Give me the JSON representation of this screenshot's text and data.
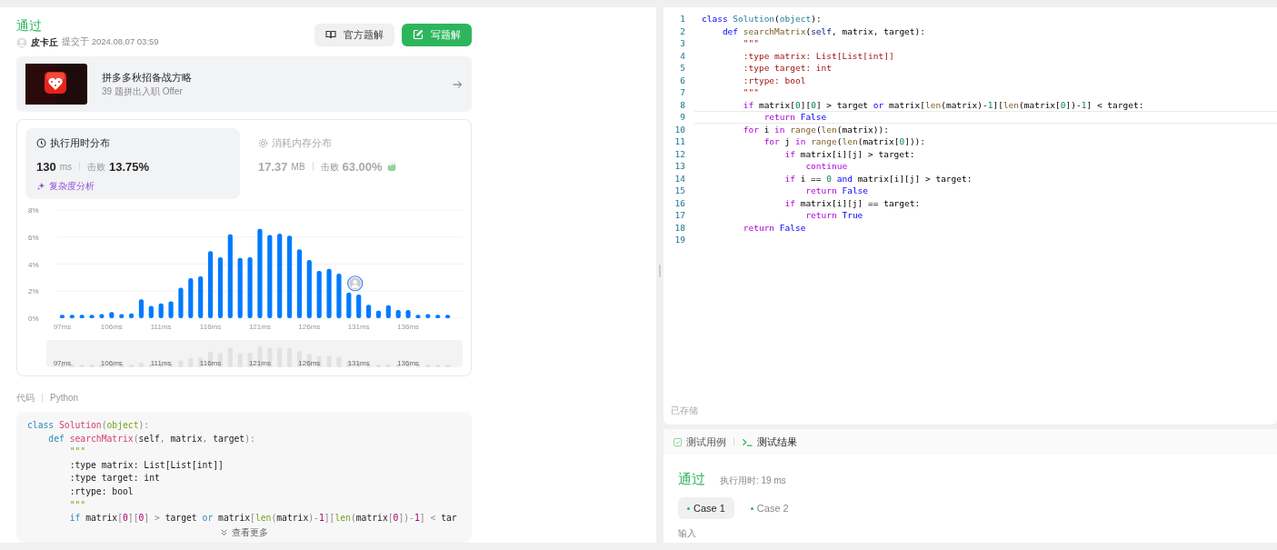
{
  "submission": {
    "status": "通过",
    "author": "皮卡丘",
    "submitted_label": "提交于",
    "time": "2024.08.07 03:59"
  },
  "actions": [
    {
      "label": "官方题解",
      "kind": "secondary"
    },
    {
      "label": "写题解",
      "kind": "primary"
    }
  ],
  "promo": {
    "title": "拼多多秋招备战方略",
    "subtitle": "39 题拼出入职 Offer"
  },
  "stats": [
    {
      "title": "执行用时分布",
      "kind": "time",
      "selected": true,
      "value": "130",
      "unit": "ms",
      "beat_label": "击败",
      "beat": "13.75%",
      "celebrate": false
    },
    {
      "title": "消耗内存分布",
      "kind": "memory",
      "selected": false,
      "value": "17.37",
      "unit": "MB",
      "beat_label": "击败",
      "beat": "63.00%",
      "celebrate": true
    }
  ],
  "analysis_link": "复杂度分析",
  "chart_data": {
    "type": "bar",
    "categories": [
      "97ms",
      null,
      null,
      null,
      null,
      "106ms",
      null,
      null,
      null,
      null,
      "111ms",
      null,
      null,
      null,
      null,
      "116ms",
      null,
      null,
      null,
      null,
      "121ms",
      null,
      null,
      null,
      null,
      "126ms",
      null,
      null,
      null,
      null,
      "131ms",
      null,
      null,
      null,
      null,
      "136ms",
      null,
      null,
      null,
      null
    ],
    "series": [
      {
        "color": "#007aff",
        "values": [
          0.25,
          0.25,
          0.25,
          0.25,
          0.3,
          0.45,
          0.3,
          0.35,
          1.4,
          0.9,
          1.1,
          1.25,
          2.25,
          2.95,
          3.1,
          4.95,
          4.5,
          6.2,
          4.45,
          4.5,
          6.6,
          6.15,
          6.25,
          6.1,
          5.1,
          4.3,
          3.5,
          3.65,
          3.3,
          1.9,
          1.75,
          1.0,
          0.55,
          0.95,
          0.6,
          0.6,
          0.25,
          0.3,
          0.25,
          0.25
        ]
      }
    ],
    "ylim": [
      0,
      8
    ],
    "yticks": [
      {
        "value": 0,
        "label": "0%"
      },
      {
        "value": 2,
        "label": "2%"
      },
      {
        "value": 4,
        "label": "4%"
      },
      {
        "value": 6,
        "label": "6%"
      },
      {
        "value": 8,
        "label": "8%"
      }
    ],
    "grid": true,
    "annotations": [
      {
        "x": "131ms"
      }
    ]
  },
  "brush_labels": [
    "97ms",
    "106ms",
    "111ms",
    "116ms",
    "121ms",
    "126ms",
    "131ms",
    "136ms"
  ],
  "code_header": {
    "label": "代码",
    "language": "Python"
  },
  "code_preview": [
    [
      {
        "kind": "kw",
        "text": "class"
      },
      {
        "kind": "cls",
        "text": " Solution"
      },
      {
        "kind": "p",
        "text": "("
      },
      {
        "kind": "bi",
        "text": "object"
      },
      {
        "kind": "p",
        "text": "):"
      }
    ],
    [
      {
        "kind": "kw",
        "text": "    def"
      },
      {
        "kind": "cls",
        "text": " searchMatrix"
      },
      {
        "kind": "p",
        "text": "("
      },
      {
        "kind": "t",
        "text": "self"
      },
      {
        "kind": "p",
        "text": ", "
      },
      {
        "kind": "t",
        "text": "matrix"
      },
      {
        "kind": "p",
        "text": ", "
      },
      {
        "kind": "t",
        "text": "target"
      },
      {
        "kind": "p",
        "text": "):"
      }
    ],
    [
      {
        "kind": "str",
        "text": "        \"\"\""
      }
    ],
    [
      {
        "kind": "t",
        "text": "        :type matrix: List[List[int]]"
      }
    ],
    [
      {
        "kind": "t",
        "text": "        :type target: int"
      }
    ],
    [
      {
        "kind": "t",
        "text": "        :rtype: bool"
      }
    ],
    [
      {
        "kind": "str",
        "text": "        \"\"\""
      }
    ],
    [
      {
        "kind": "kw",
        "text": "        if"
      },
      {
        "kind": "t",
        "text": " matrix"
      },
      {
        "kind": "p",
        "text": "["
      },
      {
        "kind": "num",
        "text": "0"
      },
      {
        "kind": "p",
        "text": "]["
      },
      {
        "kind": "num",
        "text": "0"
      },
      {
        "kind": "p",
        "text": "]"
      },
      {
        "kind": "p",
        "text": " >"
      },
      {
        "kind": "t",
        "text": " target "
      },
      {
        "kind": "kw",
        "text": "or"
      },
      {
        "kind": "t",
        "text": " matrix"
      },
      {
        "kind": "p",
        "text": "["
      },
      {
        "kind": "bi",
        "text": "len"
      },
      {
        "kind": "p",
        "text": "("
      },
      {
        "kind": "t",
        "text": "matrix"
      },
      {
        "kind": "p",
        "text": ")-"
      },
      {
        "kind": "num",
        "text": "1"
      },
      {
        "kind": "p",
        "text": "]["
      },
      {
        "kind": "bi",
        "text": "len"
      },
      {
        "kind": "p",
        "text": "("
      },
      {
        "kind": "t",
        "text": "matrix"
      },
      {
        "kind": "p",
        "text": "["
      },
      {
        "kind": "num",
        "text": "0"
      },
      {
        "kind": "p",
        "text": "])-"
      },
      {
        "kind": "num",
        "text": "1"
      },
      {
        "kind": "p",
        "text": "]"
      },
      {
        "kind": "p",
        "text": " <"
      },
      {
        "kind": "t",
        "text": " tar"
      }
    ]
  ],
  "show_more": "查看更多",
  "editor": [
    {
      "number": "1",
      "current": false,
      "tokens": [
        {
          "kind": "kw",
          "text": "class"
        },
        {
          "kind": "cls",
          "text": " Solution"
        },
        {
          "kind": "t",
          "text": "("
        },
        {
          "kind": "cls",
          "text": "object"
        },
        {
          "kind": "t",
          "text": "):"
        }
      ]
    },
    {
      "number": "2",
      "current": false,
      "tokens": [
        {
          "kind": "kw",
          "text": "    def"
        },
        {
          "kind": "fn",
          "text": " searchMatrix"
        },
        {
          "kind": "t",
          "text": "("
        },
        {
          "kind": "self",
          "text": "self"
        },
        {
          "kind": "t",
          "text": ", matrix, target):"
        }
      ]
    },
    {
      "number": "3",
      "current": false,
      "tokens": [
        {
          "kind": "str",
          "text": "        \"\"\""
        }
      ]
    },
    {
      "number": "4",
      "current": false,
      "tokens": [
        {
          "kind": "str",
          "text": "        :type matrix: List[List[int]]"
        }
      ]
    },
    {
      "number": "5",
      "current": false,
      "tokens": [
        {
          "kind": "str",
          "text": "        :type target: int"
        }
      ]
    },
    {
      "number": "6",
      "current": false,
      "tokens": [
        {
          "kind": "str",
          "text": "        :rtype: bool"
        }
      ]
    },
    {
      "number": "7",
      "current": false,
      "tokens": [
        {
          "kind": "str",
          "text": "        \"\"\""
        }
      ]
    },
    {
      "number": "8",
      "current": false,
      "tokens": [
        {
          "kind": "ctl",
          "text": "        if"
        },
        {
          "kind": "t",
          "text": " matrix["
        },
        {
          "kind": "num",
          "text": "0"
        },
        {
          "kind": "t",
          "text": "]["
        },
        {
          "kind": "num",
          "text": "0"
        },
        {
          "kind": "t",
          "text": "] > target "
        },
        {
          "kind": "kw",
          "text": "or"
        },
        {
          "kind": "t",
          "text": " matrix["
        },
        {
          "kind": "fn",
          "text": "len"
        },
        {
          "kind": "t",
          "text": "(matrix)-"
        },
        {
          "kind": "num",
          "text": "1"
        },
        {
          "kind": "t",
          "text": "]["
        },
        {
          "kind": "fn",
          "text": "len"
        },
        {
          "kind": "t",
          "text": "(matrix["
        },
        {
          "kind": "num",
          "text": "0"
        },
        {
          "kind": "t",
          "text": "])-"
        },
        {
          "kind": "num",
          "text": "1"
        },
        {
          "kind": "t",
          "text": "] < target:"
        }
      ]
    },
    {
      "number": "9",
      "current": true,
      "tokens": [
        {
          "kind": "ctl",
          "text": "            return"
        },
        {
          "kind": "kw",
          "text": " False"
        }
      ]
    },
    {
      "number": "10",
      "current": false,
      "tokens": [
        {
          "kind": "ctl",
          "text": "        for"
        },
        {
          "kind": "t",
          "text": " i "
        },
        {
          "kind": "ctl",
          "text": "in"
        },
        {
          "kind": "fn",
          "text": " range"
        },
        {
          "kind": "t",
          "text": "("
        },
        {
          "kind": "fn",
          "text": "len"
        },
        {
          "kind": "t",
          "text": "(matrix)):"
        }
      ]
    },
    {
      "number": "11",
      "current": false,
      "tokens": [
        {
          "kind": "ctl",
          "text": "            for"
        },
        {
          "kind": "t",
          "text": " j "
        },
        {
          "kind": "ctl",
          "text": "in"
        },
        {
          "kind": "fn",
          "text": " range"
        },
        {
          "kind": "t",
          "text": "("
        },
        {
          "kind": "fn",
          "text": "len"
        },
        {
          "kind": "t",
          "text": "(matrix["
        },
        {
          "kind": "num",
          "text": "0"
        },
        {
          "kind": "t",
          "text": "])):"
        }
      ]
    },
    {
      "number": "12",
      "current": false,
      "tokens": [
        {
          "kind": "ctl",
          "text": "                if"
        },
        {
          "kind": "t",
          "text": " matrix[i][j] > target:"
        }
      ]
    },
    {
      "number": "13",
      "current": false,
      "tokens": [
        {
          "kind": "ctl",
          "text": "                    continue"
        }
      ]
    },
    {
      "number": "14",
      "current": false,
      "tokens": [
        {
          "kind": "ctl",
          "text": "                if"
        },
        {
          "kind": "t",
          "text": " i == "
        },
        {
          "kind": "num",
          "text": "0"
        },
        {
          "kind": "kw",
          "text": " and"
        },
        {
          "kind": "t",
          "text": " matrix[i][j] > target:"
        }
      ]
    },
    {
      "number": "15",
      "current": false,
      "tokens": [
        {
          "kind": "ctl",
          "text": "                    return"
        },
        {
          "kind": "kw",
          "text": " False"
        }
      ]
    },
    {
      "number": "16",
      "current": false,
      "tokens": [
        {
          "kind": "ctl",
          "text": "                if"
        },
        {
          "kind": "t",
          "text": " matrix[i][j] == target:"
        }
      ]
    },
    {
      "number": "17",
      "current": false,
      "tokens": [
        {
          "kind": "ctl",
          "text": "                    return"
        },
        {
          "kind": "kw",
          "text": " True"
        }
      ]
    },
    {
      "number": "18",
      "current": false,
      "tokens": [
        {
          "kind": "ctl",
          "text": "        return"
        },
        {
          "kind": "kw",
          "text": " False"
        }
      ]
    },
    {
      "number": "19",
      "current": false
    }
  ],
  "editor_status": "已存储",
  "result_tabs": [
    {
      "label": "测试用例",
      "kind": "cases",
      "selected": false
    },
    {
      "label": "测试结果",
      "kind": "terminal",
      "selected": true
    }
  ],
  "result": {
    "status": "通过",
    "runtime": "执行用时: 19 ms"
  },
  "cases": [
    {
      "label": "Case 1",
      "selected": true
    },
    {
      "label": "Case 2",
      "selected": false
    }
  ],
  "input_label": "输入"
}
